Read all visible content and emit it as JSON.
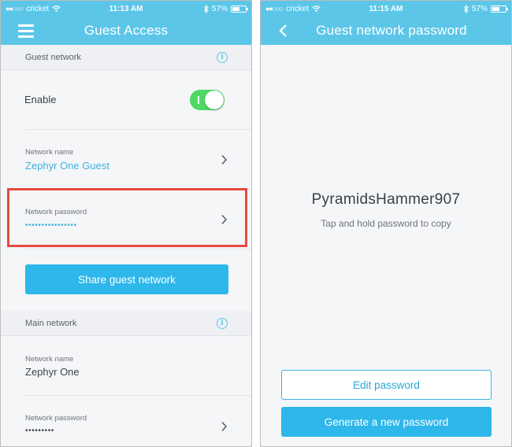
{
  "colors": {
    "accent": "#5cc6e8",
    "button": "#2db7ea",
    "toggle_on": "#4cd964",
    "highlight": "#e64b3c",
    "link_text": "#2aa8d8"
  },
  "left_screen": {
    "status": {
      "carrier_dots": "●●○○○",
      "carrier": "cricket",
      "time": "11:13 AM",
      "battery": "57%",
      "battery_level": 0.57
    },
    "title": "Guest Access",
    "guest_section": {
      "header": "Guest network",
      "enable_label": "Enable",
      "enable_on": true,
      "network_name_label": "Network name",
      "network_name_value": "Zephyr One Guest",
      "network_password_label": "Network password",
      "network_password_value": "••••••••••••••••",
      "share_button": "Share guest network"
    },
    "main_section": {
      "header": "Main network",
      "network_name_label": "Network name",
      "network_name_value": "Zephyr One",
      "network_password_label": "Network password",
      "network_password_value": "•••••••••"
    }
  },
  "right_screen": {
    "status": {
      "carrier_dots": "●●○○○",
      "carrier": "cricket",
      "time": "11:15 AM",
      "battery": "57%",
      "battery_level": 0.57
    },
    "title": "Guest network password",
    "password": "PyramidsHammer907",
    "hint": "Tap and hold password to copy",
    "edit_button": "Edit password",
    "generate_button": "Generate a new password"
  }
}
